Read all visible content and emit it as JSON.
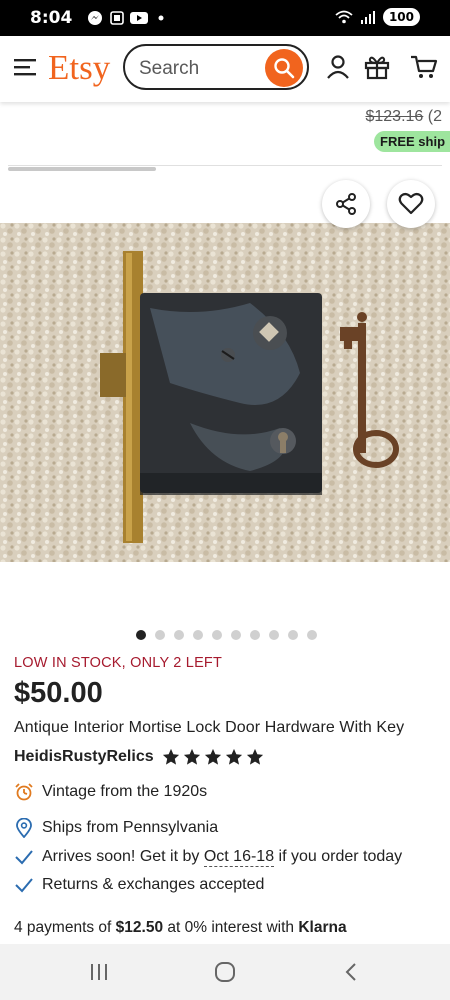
{
  "status_bar": {
    "time": "8:04",
    "battery": "100"
  },
  "header": {
    "logo": "Etsy",
    "search_placeholder": "Search"
  },
  "previous_listing": {
    "old_price": "$123.16",
    "old_price_suffix": " (2",
    "free_shipping": "FREE ship"
  },
  "gallery": {
    "dot_count": 10,
    "active_dot": 0
  },
  "listing": {
    "stock_notice": "LOW IN STOCK, ONLY 2 LEFT",
    "price": "$50.00",
    "title": "Antique Interior Mortise Lock Door Hardware With Key",
    "shop_name": "HeidisRustyRelics",
    "rating": 5
  },
  "details": {
    "vintage": "Vintage from the 1920s",
    "ships_from": "Ships from Pennsylvania",
    "arrives_prefix": "Arrives soon! Get it by ",
    "arrives_dates": "Oct 16-18",
    "arrives_suffix": " if you order today",
    "returns": "Returns & exchanges accepted"
  },
  "klarna": {
    "prefix": "4 payments of ",
    "amount": "$12.50",
    "middle": " at 0% interest with ",
    "brand": "Klarna"
  },
  "colors": {
    "etsy_orange": "#f1641e",
    "stock_red": "#a61a2e",
    "free_ship_green": "#9ee59e",
    "check_blue": "#2b6cb0"
  }
}
